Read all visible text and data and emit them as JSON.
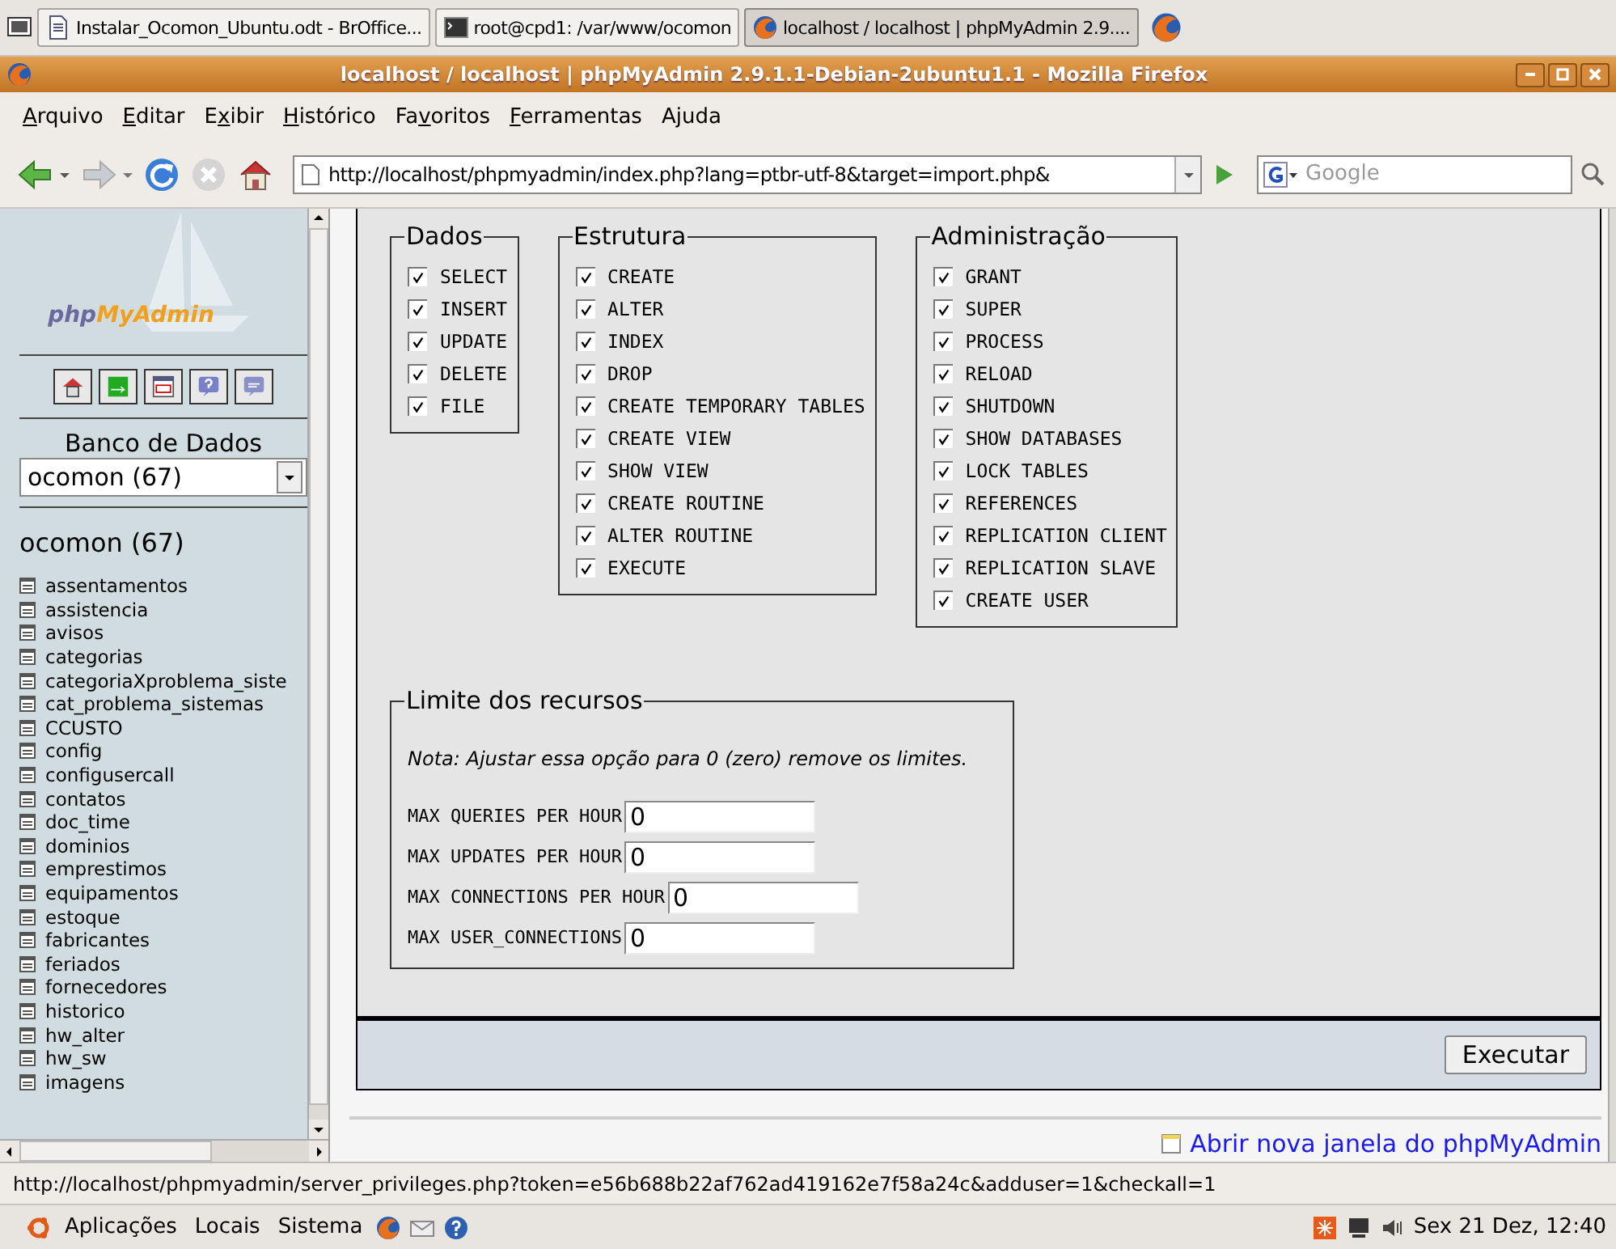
{
  "taskbar": {
    "tasks": [
      {
        "label": "Instalar_Ocomon_Ubuntu.odt - BrOffice...",
        "kind": "document",
        "selected": false
      },
      {
        "label": "root@cpd1: /var/www/ocomon",
        "kind": "terminal",
        "selected": false
      },
      {
        "label": "localhost / localhost | phpMyAdmin 2.9....",
        "kind": "browser",
        "selected": true
      }
    ]
  },
  "window": {
    "title": "localhost / localhost | phpMyAdmin 2.9.1.1-Debian-2ubuntu1.1 - Mozilla Firefox"
  },
  "menu": [
    {
      "key": "A",
      "after": "rquivo"
    },
    {
      "key": "E",
      "after": "ditar"
    },
    {
      "before": "E",
      "key": "x",
      "after": "ibir"
    },
    {
      "key": "H",
      "after": "istórico"
    },
    {
      "before": "Fa",
      "key": "v",
      "after": "oritos"
    },
    {
      "key": "F",
      "after": "erramentas"
    },
    {
      "before": "A",
      "key": "j",
      "after": "uda"
    }
  ],
  "toolbar": {
    "url": "http://localhost/phpmyadmin/index.php?lang=ptbr-utf-8&target=import.php&",
    "search_placeholder": "Google"
  },
  "sidebar": {
    "logo": {
      "prefix": "php",
      "suffix": "MyAdmin"
    },
    "db_label": "Banco de Dados",
    "db_select": "ocomon (67)",
    "db_heading": "ocomon (67)",
    "tables": [
      "assentamentos",
      "assistencia",
      "avisos",
      "categorias",
      "categoriaXproblema_siste",
      "cat_problema_sistemas",
      "CCUSTO",
      "config",
      "configusercall",
      "contatos",
      "doc_time",
      "dominios",
      "emprestimos",
      "equipamentos",
      "estoque",
      "fabricantes",
      "feriados",
      "fornecedores",
      "historico",
      "hw_alter",
      "hw_sw",
      "imagens"
    ]
  },
  "groups": [
    {
      "legend": "Dados",
      "items": [
        {
          "label": "SELECT",
          "checked": true
        },
        {
          "label": "INSERT",
          "checked": true
        },
        {
          "label": "UPDATE",
          "checked": true
        },
        {
          "label": "DELETE",
          "checked": true
        },
        {
          "label": "FILE",
          "checked": true
        }
      ]
    },
    {
      "legend": "Estrutura",
      "items": [
        {
          "label": "CREATE",
          "checked": true
        },
        {
          "label": "ALTER",
          "checked": true
        },
        {
          "label": "INDEX",
          "checked": true
        },
        {
          "label": "DROP",
          "checked": true
        },
        {
          "label": "CREATE TEMPORARY TABLES",
          "checked": true
        },
        {
          "label": "CREATE VIEW",
          "checked": true
        },
        {
          "label": "SHOW VIEW",
          "checked": true
        },
        {
          "label": "CREATE ROUTINE",
          "checked": true
        },
        {
          "label": "ALTER ROUTINE",
          "checked": true
        },
        {
          "label": "EXECUTE",
          "checked": true
        }
      ]
    },
    {
      "legend": "Administração",
      "items": [
        {
          "label": "GRANT",
          "checked": true
        },
        {
          "label": "SUPER",
          "checked": true
        },
        {
          "label": "PROCESS",
          "checked": true
        },
        {
          "label": "RELOAD",
          "checked": true
        },
        {
          "label": "SHUTDOWN",
          "checked": true
        },
        {
          "label": "SHOW DATABASES",
          "checked": true
        },
        {
          "label": "LOCK TABLES",
          "checked": true
        },
        {
          "label": "REFERENCES",
          "checked": true
        },
        {
          "label": "REPLICATION CLIENT",
          "checked": true
        },
        {
          "label": "REPLICATION SLAVE",
          "checked": true
        },
        {
          "label": "CREATE USER",
          "checked": true
        }
      ]
    }
  ],
  "limits": {
    "legend": "Limite dos recursos",
    "note": "Nota: Ajustar essa opção para 0 (zero) remove os limites.",
    "fields": [
      {
        "label": "MAX QUERIES PER HOUR",
        "value": "0"
      },
      {
        "label": "MAX UPDATES PER HOUR",
        "value": "0"
      },
      {
        "label": "MAX CONNECTIONS PER HOUR",
        "value": "0"
      },
      {
        "label": "MAX USER_CONNECTIONS",
        "value": "0"
      }
    ]
  },
  "submit": "Executar",
  "new_window_link": "Abrir nova janela do phpMyAdmin",
  "status_bar": "http://localhost/phpmyadmin/server_privileges.php?token=e56b688b22af762ad419162e7f58a24c&adduser=1&checkall=1",
  "panel": {
    "menus": [
      "Aplicações",
      "Locais",
      "Sistema"
    ],
    "clock": "Sex 21 Dez, 12:40"
  }
}
